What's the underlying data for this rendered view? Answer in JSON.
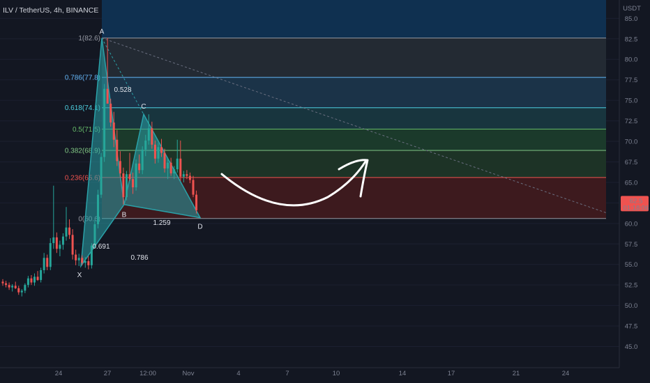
{
  "header": {
    "title": "ILV / TetherUS, 4h, BINANCE"
  },
  "colors": {
    "background": "#131722",
    "up": "#26a69a",
    "down": "#ef5350",
    "pattern": "#2aa1a8",
    "price_tag": "#ef5350"
  },
  "chart_data": {
    "type": "candlestick",
    "currency": "USDT",
    "yaxis": {
      "ticks": [
        "85.0",
        "82.5",
        "80.0",
        "77.5",
        "75.0",
        "72.5",
        "70.0",
        "67.5",
        "65.0",
        "62.5",
        "60.0",
        "57.5",
        "55.0",
        "52.5",
        "50.0",
        "47.5",
        "45.0"
      ],
      "range": [
        44.5,
        89
      ]
    },
    "xaxis": {
      "ticks": [
        "24",
        "27",
        "12:00",
        "Nov",
        "4",
        "7",
        "10",
        "14",
        "17",
        "21",
        "24"
      ]
    },
    "last_price": {
      "value": "62.5",
      "countdown": "01:18:06"
    },
    "fibonacci": [
      {
        "label": "1(82.6)",
        "price": 82.6,
        "color": "#9598a1"
      },
      {
        "label": "0.786(77.8)",
        "price": 77.8,
        "color": "#64b5f6"
      },
      {
        "label": "0.618(74.1)",
        "price": 74.1,
        "color": "#4dd0e1"
      },
      {
        "label": "0.5(71.5)",
        "price": 71.5,
        "color": "#66bb6a"
      },
      {
        "label": "0.382(68.9)",
        "price": 68.9,
        "color": "#81c784"
      },
      {
        "label": "0.236(65.6)",
        "price": 65.6,
        "color": "#ef5350"
      },
      {
        "label": "0(60.6)",
        "price": 60.6,
        "color": "#9598a1"
      }
    ],
    "harmonic_pattern": {
      "points": [
        {
          "name": "X",
          "price": 54.8
        },
        {
          "name": "A",
          "price": 82.6
        },
        {
          "name": "B",
          "price": 62.3
        },
        {
          "name": "C",
          "price": 73.3
        },
        {
          "name": "D",
          "price": 60.7
        }
      ],
      "ratios": [
        "0.528",
        "0.691",
        "0.786",
        "1.259"
      ]
    },
    "candles": [
      [
        52.9,
        53.2,
        52.4,
        52.7
      ],
      [
        52.7,
        53.0,
        52.2,
        52.5
      ],
      [
        52.5,
        52.8,
        51.9,
        52.2
      ],
      [
        52.2,
        52.6,
        51.7,
        52.4
      ],
      [
        52.4,
        52.9,
        52.0,
        52.1
      ],
      [
        52.1,
        52.4,
        51.3,
        51.6
      ],
      [
        51.6,
        52.0,
        51.1,
        51.8
      ],
      [
        51.8,
        52.7,
        51.5,
        52.5
      ],
      [
        52.5,
        53.6,
        52.2,
        53.3
      ],
      [
        53.3,
        53.7,
        52.5,
        52.8
      ],
      [
        52.8,
        53.9,
        52.4,
        53.5
      ],
      [
        53.5,
        54.2,
        53.0,
        53.1
      ],
      [
        53.1,
        54.6,
        52.8,
        54.3
      ],
      [
        54.3,
        56.4,
        53.9,
        55.8
      ],
      [
        55.8,
        56.2,
        54.3,
        54.7
      ],
      [
        54.7,
        58.2,
        54.3,
        57.6
      ],
      [
        57.6,
        64.6,
        56.9,
        58.3
      ],
      [
        58.3,
        58.9,
        56.4,
        56.9
      ],
      [
        56.9,
        57.9,
        56.0,
        57.4
      ],
      [
        57.4,
        58.8,
        56.8,
        58.4
      ],
      [
        58.4,
        62.0,
        57.9,
        59.5
      ],
      [
        59.5,
        60.5,
        58.1,
        58.6
      ],
      [
        58.6,
        59.3,
        55.6,
        56.2
      ],
      [
        56.2,
        56.8,
        54.9,
        55.5
      ],
      [
        55.5,
        56.3,
        54.8,
        55.8
      ],
      [
        55.8,
        56.1,
        54.9,
        55.2
      ],
      [
        55.2,
        55.9,
        54.6,
        55.4
      ],
      [
        55.4,
        56.0,
        54.4,
        54.9
      ],
      [
        54.9,
        57.6,
        54.5,
        57.3
      ],
      [
        57.3,
        60.4,
        57.0,
        59.9
      ],
      [
        59.9,
        64.1,
        59.4,
        63.5
      ],
      [
        63.5,
        68.6,
        63.1,
        68.1
      ],
      [
        68.1,
        77.0,
        67.5,
        76.4
      ],
      [
        76.4,
        82.6,
        75.6,
        74.6
      ],
      [
        74.6,
        75.2,
        71.8,
        72.3
      ],
      [
        72.3,
        73.6,
        69.3,
        70.2
      ],
      [
        70.2,
        71.4,
        67.0,
        67.6
      ],
      [
        67.6,
        68.8,
        65.6,
        66.1
      ],
      [
        66.1,
        66.8,
        62.3,
        63.2
      ],
      [
        63.2,
        66.4,
        62.8,
        66.0
      ],
      [
        66.0,
        68.6,
        65.2,
        65.4
      ],
      [
        65.4,
        66.2,
        63.6,
        64.4
      ],
      [
        64.4,
        67.8,
        64.0,
        67.3
      ],
      [
        67.3,
        68.4,
        66.1,
        66.5
      ],
      [
        66.5,
        69.4,
        66.0,
        69.0
      ],
      [
        69.0,
        70.8,
        68.2,
        70.1
      ],
      [
        70.1,
        73.3,
        69.6,
        71.6
      ],
      [
        71.6,
        72.4,
        69.1,
        69.6
      ],
      [
        69.6,
        70.1,
        67.3,
        67.9
      ],
      [
        67.9,
        69.8,
        67.4,
        69.3
      ],
      [
        69.3,
        70.3,
        68.1,
        68.6
      ],
      [
        68.6,
        69.1,
        66.2,
        66.7
      ],
      [
        66.7,
        67.9,
        65.4,
        67.4
      ],
      [
        67.4,
        68.0,
        65.8,
        66.1
      ],
      [
        66.1,
        67.0,
        65.4,
        66.6
      ],
      [
        66.6,
        70.2,
        66.2,
        67.9
      ],
      [
        67.9,
        70.1,
        65.2,
        65.7
      ],
      [
        65.7,
        66.4,
        65.0,
        66.0
      ],
      [
        66.0,
        66.5,
        65.4,
        65.8
      ],
      [
        65.8,
        66.2,
        64.9,
        65.3
      ],
      [
        65.3,
        65.8,
        63.2,
        63.5
      ],
      [
        63.5,
        64.0,
        61.2,
        61.6
      ]
    ]
  }
}
